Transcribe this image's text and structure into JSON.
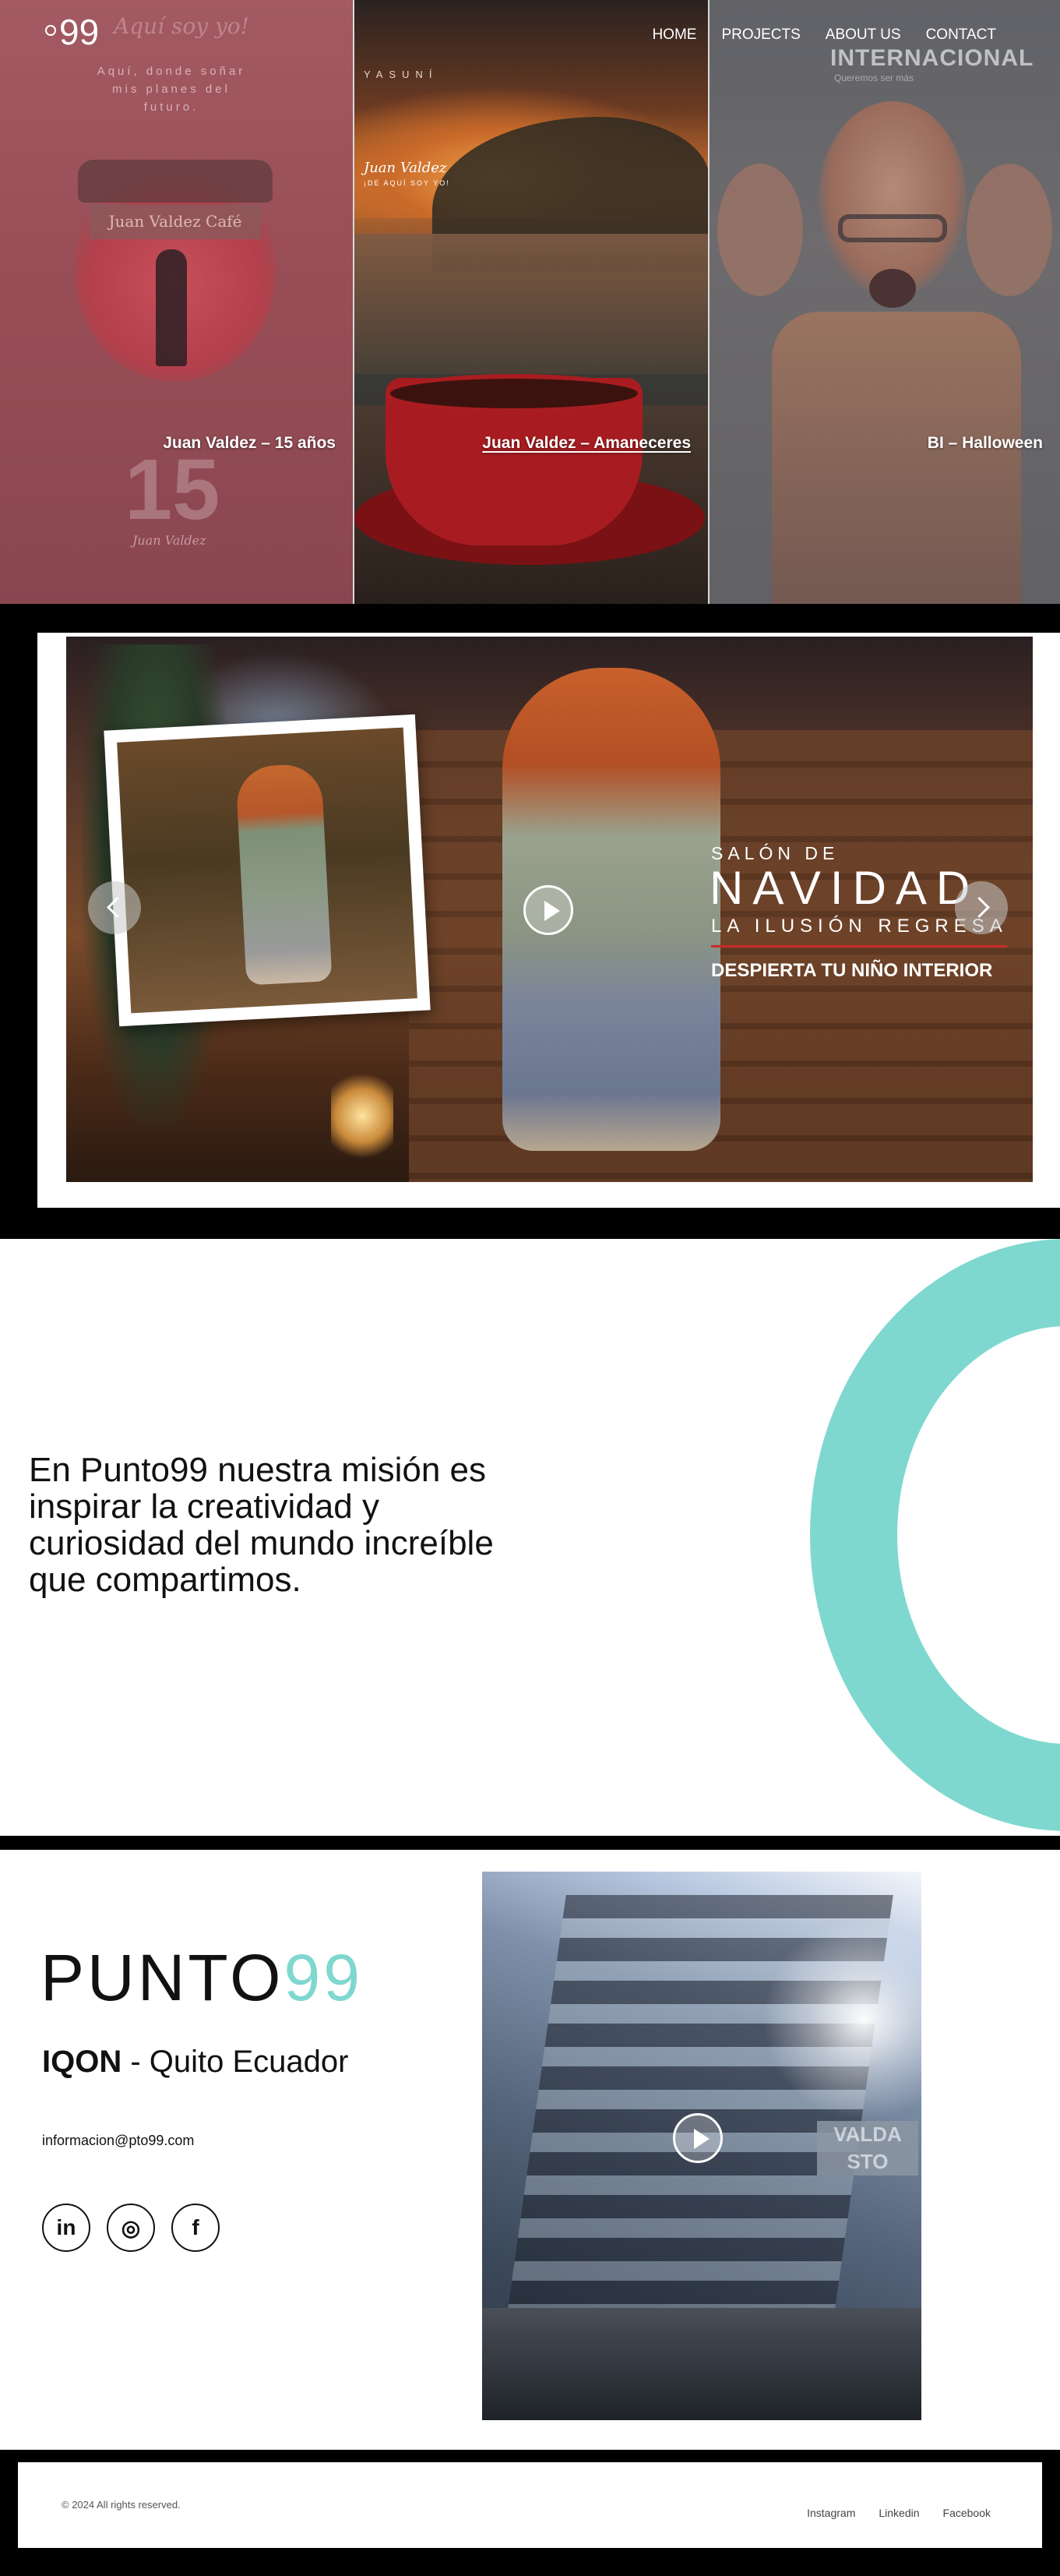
{
  "header": {
    "logo": "99",
    "logo_script": "Aquí soy yo!",
    "nav": [
      "HOME",
      "PROJECTS",
      "ABOUT US",
      "CONTACT"
    ]
  },
  "projects": [
    {
      "title": "Juan Valdez – 15 años",
      "quote": "Aquí, donde soñar mis planes del futuro.",
      "cup_label": "Juan Valdez Café",
      "big_number": "15",
      "brand_mark": "Juan Valdez"
    },
    {
      "title": "Juan Valdez – Amaneceres",
      "place": "YASUNÍ",
      "brand": "Juan Valdez",
      "tagline": "¡DE AQUÍ SOY YO!"
    },
    {
      "title": "BI – Halloween",
      "brand": "INTERNACIONAL",
      "brand_sub": "Queremos ser más"
    }
  ],
  "video_banner": {
    "eyebrow": "SALÓN DE",
    "headline": "NAVIDAD",
    "subheadline": "LA ILUSIÓN REGRESA",
    "tagline": "DESPIERTA TU NIÑO INTERIOR"
  },
  "mission": {
    "text": "En Punto99 nuestra misión es inspirar la creatividad y curiosidad del mundo increíble que compartimos.",
    "accent_color": "#7fd8cf"
  },
  "contact": {
    "brand_word": "PUNTO",
    "brand_num": "99",
    "location_bold": "IQON",
    "location_rest": " - Quito Ecuador",
    "email": "informacion@pto99.com",
    "socials": [
      {
        "name": "linkedin-icon",
        "glyph": "in"
      },
      {
        "name": "instagram-icon",
        "glyph": "◎"
      },
      {
        "name": "facebook-icon",
        "glyph": "f"
      }
    ],
    "building_sign": "VALDA STO"
  },
  "footer": {
    "copyright": "© 2024 All rights reserved.",
    "links": [
      "Instagram",
      "Linkedin",
      "Facebook"
    ]
  }
}
